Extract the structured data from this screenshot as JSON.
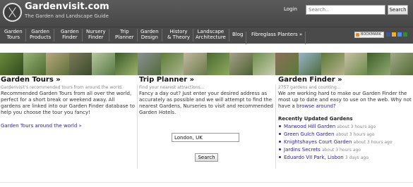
{
  "header": {
    "site_name": "Gardenvisit.com",
    "tagline": "The Garden and Landscape Guide",
    "login_label": "Login",
    "search_placeholder": "Search..",
    "search_button": "Search"
  },
  "nav": {
    "items": [
      {
        "line1": "Garden",
        "line2": "Tours"
      },
      {
        "line1": "Garden",
        "line2": "Products"
      },
      {
        "line1": "Garden",
        "line2": "Finder"
      },
      {
        "line1": "Nursery",
        "line2": "Finder"
      },
      {
        "line1": "Trip",
        "line2": "Planner"
      },
      {
        "line1": "Garden",
        "line2": "Design"
      },
      {
        "line1": "History",
        "line2": "& Theory"
      },
      {
        "line1": "Landscape",
        "line2": "Architecture"
      },
      {
        "line1": "Blog",
        "line2": ""
      },
      {
        "line1": "Fibreglass Planters »",
        "line2": ""
      }
    ],
    "bookmark_label": "BOOKMARK"
  },
  "colors": {
    "header_bg": "#4f4f4f",
    "link": "#2a1fa0"
  },
  "garden_tours": {
    "title": "Garden Tours »",
    "subtitle": "Gardenvisit's recommended tours from around the world.",
    "body": "Recommended Garden Tours from all over the world, perfect for a short break or weekend away. All gardens are linked into our Garden Finder database to help you choose the tour you fancy!",
    "link": "Garden Tours around the world »"
  },
  "trip_planner": {
    "title": "Trip Planner »",
    "subtitle": "Find your nearest attractions...",
    "body": "Fancy a day out? Just enter your desired address as accurately as possible and we will attempt to find the nearest Gardens, Nurseries to visit and recommended Garden Hotels.",
    "location_value": "London, UK",
    "search_button": "Search"
  },
  "garden_finder": {
    "title": "Garden Finder »",
    "subtitle": "2757 gardens and counting...",
    "body_before": "We are working hard to make our Garden Finder the most up to date and easy to use on the web. Why not have a ",
    "browse_link": "browse around?",
    "recent_title": "Recently Updated Gardens",
    "recent": [
      {
        "name": "Marwood Hill Garden",
        "ago": "about 3 hours ago"
      },
      {
        "name": "Green Gulch Garden",
        "ago": "about 3 hours ago"
      },
      {
        "name": "Knightshayes Court Garden",
        "ago": "about 3 hours ago"
      },
      {
        "name": "Jardins Secrets",
        "ago": "about 3 hours ago"
      },
      {
        "name": "Eduardo VII Park, Lisbon",
        "ago": "3 days ago"
      }
    ]
  }
}
